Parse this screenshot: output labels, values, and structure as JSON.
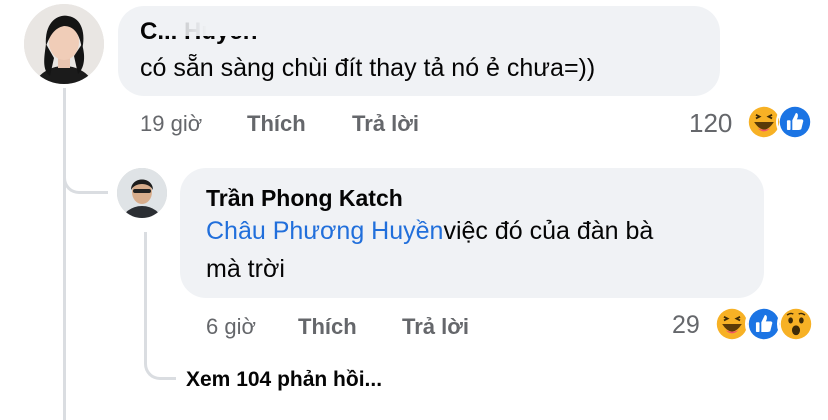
{
  "comment": {
    "author": "C... Huyền",
    "text": "có sẵn sàng chùi đít thay tả nó ẻ chưa=))",
    "time": "19 giờ",
    "like_label": "Thích",
    "reply_label": "Trả lời",
    "reaction_count": "120",
    "reactions": [
      "haha-icon",
      "like-icon"
    ]
  },
  "reply": {
    "author": "Trần Phong Katch",
    "mention": "Châu Phương Huyền",
    "text_line1": "việc đó của đàn bà",
    "text_line2": "mà trời",
    "time": "6 giờ",
    "like_label": "Thích",
    "reply_label": "Trả lời",
    "reaction_count": "29",
    "reactions": [
      "haha-icon",
      "like-icon",
      "wow-icon"
    ]
  },
  "view_replies": "Xem 104 phản hồi...",
  "colors": {
    "bubble": "#f0f2f5",
    "mention": "#216fdb",
    "meta": "#65676b",
    "like_blue": "#1b74e4",
    "reaction_yellow": "#f7b125"
  }
}
